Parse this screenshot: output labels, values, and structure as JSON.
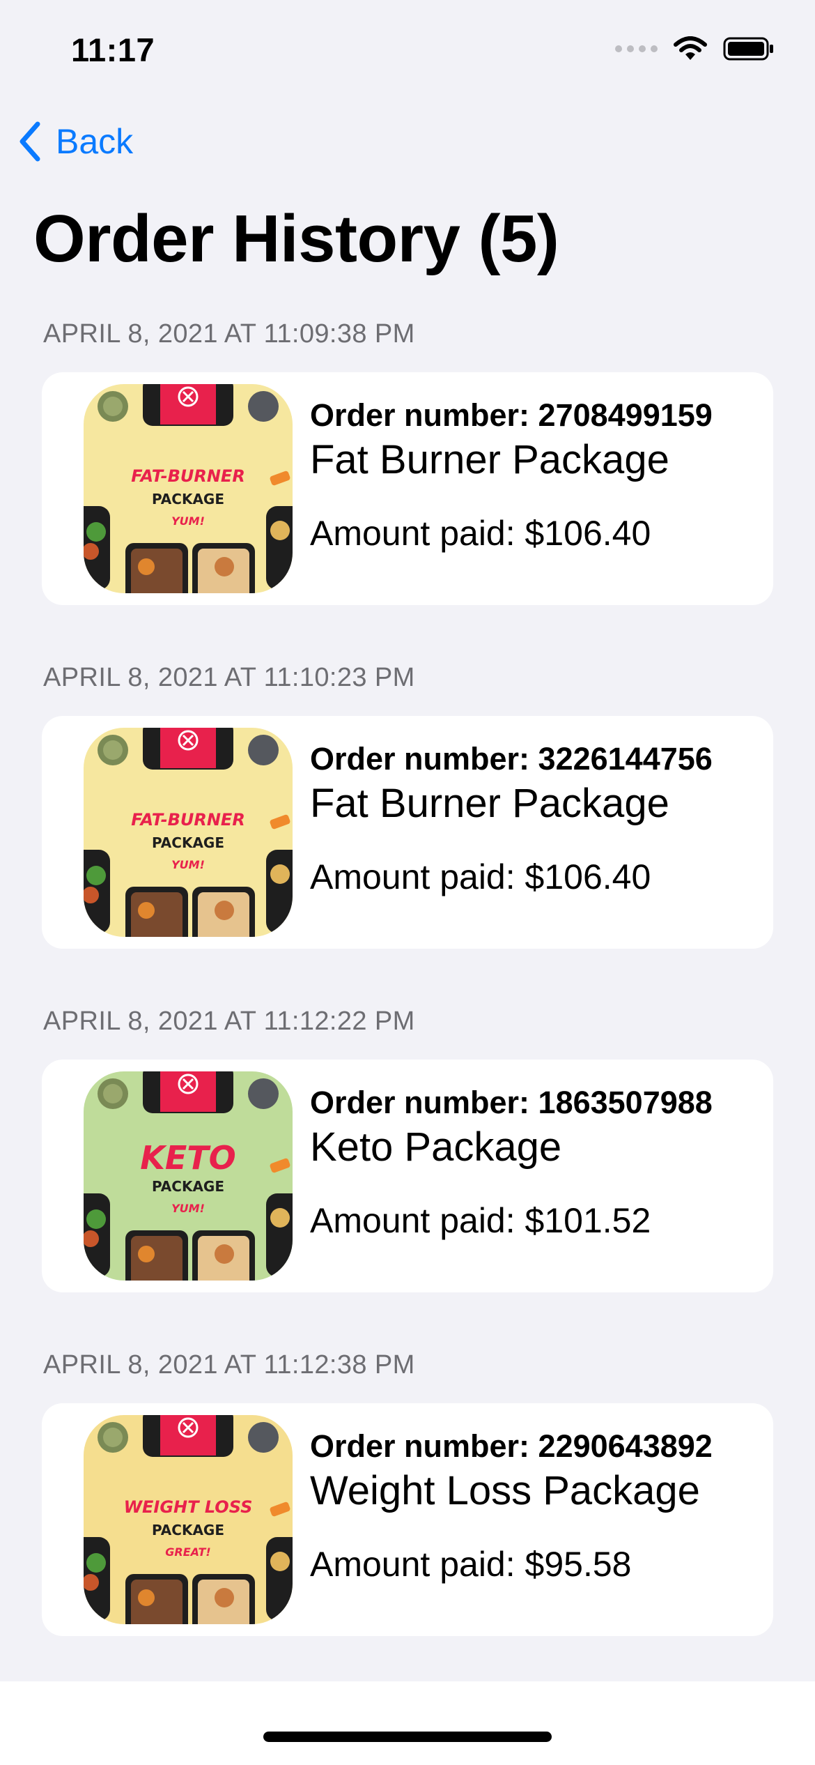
{
  "status_bar": {
    "time": "11:17"
  },
  "nav": {
    "back_label": "Back"
  },
  "page_title": "Order History (5)",
  "orders": [
    {
      "timestamp": "APRIL 8, 2021 AT 11:09:38 PM",
      "order_number": "Order number: 2708499159",
      "package_name": "Fat Burner Package",
      "amount_paid": "Amount paid: $106.40",
      "thumb_title": "FAT-BURNER",
      "thumb_sub": "PACKAGE",
      "thumb_tag": "YUM!",
      "thumb_bg": "#F6E79F"
    },
    {
      "timestamp": "APRIL 8, 2021 AT 11:10:23 PM",
      "order_number": "Order number: 3226144756",
      "package_name": "Fat Burner Package",
      "amount_paid": "Amount paid: $106.40",
      "thumb_title": "FAT-BURNER",
      "thumb_sub": "PACKAGE",
      "thumb_tag": "YUM!",
      "thumb_bg": "#F6E79F"
    },
    {
      "timestamp": "APRIL 8, 2021 AT 11:12:22 PM",
      "order_number": "Order number: 1863507988",
      "package_name": "Keto Package",
      "amount_paid": "Amount paid: $101.52",
      "thumb_title": "KETO",
      "thumb_sub": "PACKAGE",
      "thumb_tag": "YUM!",
      "thumb_bg": "#BFDC9A"
    },
    {
      "timestamp": "APRIL 8, 2021 AT 11:12:38 PM",
      "order_number": "Order number: 2290643892",
      "package_name": "Weight Loss Package",
      "amount_paid": "Amount paid: $95.58",
      "thumb_title": "WEIGHT LOSS",
      "thumb_sub": "PACKAGE",
      "thumb_tag": "GREAT!",
      "thumb_bg": "#F5DE8F"
    }
  ],
  "colors": {
    "accent": "#0A7AFF",
    "background": "#F2F2F7",
    "brand_red": "#E8214C"
  },
  "icons": [
    "signal-icon",
    "wifi-icon",
    "battery-icon",
    "chevron-left-icon"
  ]
}
